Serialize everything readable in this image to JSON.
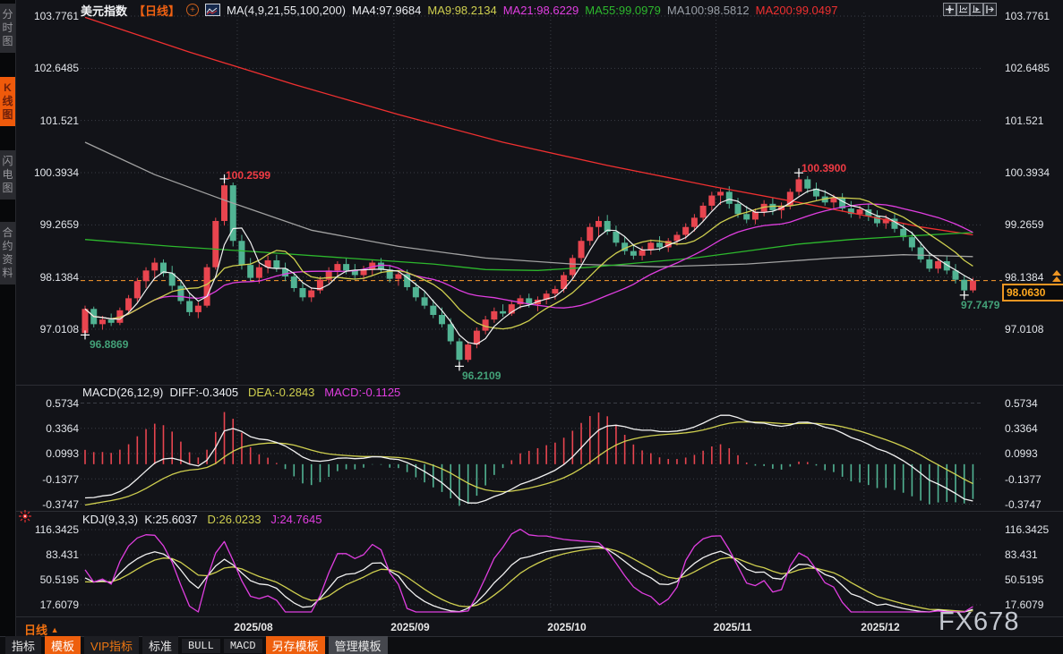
{
  "sidebar": {
    "items": [
      {
        "label": "分时图",
        "active": false
      },
      {
        "label": "K线图",
        "active": true
      },
      {
        "label": "闪电图",
        "active": false
      },
      {
        "label": "合约资料",
        "active": false
      }
    ]
  },
  "header": {
    "symbol": "美元指数",
    "period_tag": "【日线】",
    "ma_settings": "MA(4,9,21,55,100,200)",
    "ma4": "MA4:97.9684",
    "ma9": "MA9:98.2134",
    "ma21": "MA21:98.6229",
    "ma55": "MA55:99.0979",
    "ma100": "MA100:98.5812",
    "ma200": "MA200:99.0497"
  },
  "macd_header": {
    "name": "MACD(26,12,9)",
    "diff": "DIFF:-0.3405",
    "dea": "DEA:-0.2843",
    "macd": "MACD:-0.1125"
  },
  "kdj_header": {
    "name": "KDJ(9,3,3)",
    "k": "K:25.6037",
    "d": "D:26.0233",
    "j": "J:24.7645"
  },
  "annotations": {
    "high1": "100.2599",
    "low1": "96.8869",
    "low2": "96.2109",
    "high2": "100.3900",
    "low3": "97.7479",
    "last_price": "98.0630"
  },
  "timeline": {
    "period": "日线",
    "triangle": "▲",
    "dates": [
      "2025/08",
      "2025/09",
      "2025/10",
      "2025/11",
      "2025/12"
    ]
  },
  "watermark": "FX678",
  "toolbar": {
    "tabs": [
      {
        "label": "指标"
      },
      {
        "label": "模板"
      },
      {
        "label": "VIP指标"
      },
      {
        "label": "标准"
      },
      {
        "label": "BULL"
      },
      {
        "label": "MACD"
      },
      {
        "label": "另存模板"
      },
      {
        "label": "管理模板"
      }
    ]
  },
  "chart_data": {
    "type": "candlestick",
    "title": "美元指数 日线 (US Dollar Index, daily)",
    "panels": [
      "price+MA(4,9,21,55,100,200)",
      "MACD(26,12,9)",
      "KDJ(9,3,3)"
    ],
    "price_axis_ticks": [
      103.7761,
      102.6485,
      101.521,
      100.3934,
      99.2659,
      98.1384,
      97.0108
    ],
    "macd_axis_ticks": [
      0.5734,
      0.3364,
      0.0993,
      -0.1377,
      -0.3747
    ],
    "kdj_axis_ticks": [
      116.3425,
      83.431,
      50.5195,
      17.6079
    ],
    "last_price": 98.063,
    "month_labels": [
      "2025/08",
      "2025/09",
      "2025/10",
      "2025/11",
      "2025/12"
    ],
    "month_start_indices": [
      18,
      36,
      54,
      73,
      90
    ],
    "markers": [
      {
        "index": 0,
        "price": 96.8869,
        "type": "low"
      },
      {
        "index": 16,
        "price": 100.2599,
        "type": "high"
      },
      {
        "index": 43,
        "price": 96.2109,
        "type": "low"
      },
      {
        "index": 82,
        "price": 100.39,
        "type": "high"
      },
      {
        "index": 101,
        "price": 97.7479,
        "type": "low"
      }
    ],
    "ma_computed_periods": [
      4,
      9,
      21
    ],
    "ma_overlays": {
      "ma55": [
        [
          0,
          98.95
        ],
        [
          10,
          98.8
        ],
        [
          20,
          98.68
        ],
        [
          30,
          98.55
        ],
        [
          40,
          98.42
        ],
        [
          46,
          98.3
        ],
        [
          52,
          98.28
        ],
        [
          58,
          98.35
        ],
        [
          64,
          98.45
        ],
        [
          70,
          98.55
        ],
        [
          76,
          98.7
        ],
        [
          82,
          98.85
        ],
        [
          88,
          98.95
        ],
        [
          94,
          99.02
        ],
        [
          102,
          99.1
        ]
      ],
      "ma100": [
        [
          0,
          101.05
        ],
        [
          8,
          100.35
        ],
        [
          16,
          99.8
        ],
        [
          26,
          99.15
        ],
        [
          36,
          98.8
        ],
        [
          46,
          98.55
        ],
        [
          56,
          98.42
        ],
        [
          66,
          98.36
        ],
        [
          76,
          98.42
        ],
        [
          86,
          98.55
        ],
        [
          94,
          98.62
        ],
        [
          102,
          98.58
        ]
      ],
      "ma200": [
        [
          0,
          103.75
        ],
        [
          12,
          103.0
        ],
        [
          24,
          102.3
        ],
        [
          36,
          101.65
        ],
        [
          48,
          101.05
        ],
        [
          60,
          100.55
        ],
        [
          72,
          100.1
        ],
        [
          82,
          99.75
        ],
        [
          90,
          99.45
        ],
        [
          96,
          99.22
        ],
        [
          102,
          99.05
        ]
      ]
    },
    "macd": {
      "fast": 12,
      "slow": 26,
      "signal": 9,
      "last": {
        "diff": -0.3405,
        "dea": -0.2843,
        "macd": -0.1125
      }
    },
    "kdj": {
      "n": 9,
      "m1": 3,
      "m2": 3,
      "last": {
        "k": 25.6037,
        "d": 26.0233,
        "j": 24.7645
      }
    },
    "colors": {
      "up": "#e8454f",
      "down": "#51b393",
      "ma4": "#f2f2f2",
      "ma9": "#cfcf4f",
      "ma21": "#e03ee0",
      "ma55": "#2db82d",
      "ma100": "#a2a2a2",
      "ma200": "#f03030",
      "diff": "#f2f2f2",
      "dea": "#cfcf4f",
      "hist_pos": "#e8454f",
      "hist_neg": "#51b393",
      "k": "#f2f2f2",
      "d": "#cfcf4f",
      "j": "#e03ee0",
      "last_price": "#ff9d2e",
      "grid": "#3b3e46",
      "marker_cross": "#ffffff",
      "annotation_high": "#f03b44",
      "annotation_low": "#43a178"
    },
    "candles": [
      [
        96.93,
        97.52,
        96.8869,
        97.45
      ],
      [
        97.45,
        97.5,
        97.05,
        97.12
      ],
      [
        97.12,
        97.3,
        97.0,
        97.22
      ],
      [
        97.22,
        97.35,
        97.08,
        97.15
      ],
      [
        97.15,
        97.48,
        97.1,
        97.42
      ],
      [
        97.42,
        97.75,
        97.35,
        97.68
      ],
      [
        97.68,
        98.12,
        97.6,
        98.05
      ],
      [
        98.05,
        98.35,
        97.9,
        98.28
      ],
      [
        98.28,
        98.55,
        98.1,
        98.45
      ],
      [
        98.45,
        98.52,
        98.15,
        98.22
      ],
      [
        98.22,
        98.38,
        97.85,
        97.95
      ],
      [
        97.95,
        98.05,
        97.55,
        97.62
      ],
      [
        97.62,
        97.8,
        97.3,
        97.38
      ],
      [
        97.38,
        97.6,
        97.25,
        97.52
      ],
      [
        97.52,
        98.42,
        97.48,
        98.35
      ],
      [
        98.35,
        99.42,
        98.3,
        99.35
      ],
      [
        99.35,
        100.2599,
        99.25,
        100.12
      ],
      [
        100.12,
        100.18,
        98.8,
        98.92
      ],
      [
        98.92,
        99.05,
        98.3,
        98.4
      ],
      [
        98.4,
        98.55,
        98.05,
        98.12
      ],
      [
        98.12,
        98.42,
        98.0,
        98.35
      ],
      [
        98.35,
        98.6,
        98.22,
        98.5
      ],
      [
        98.5,
        98.62,
        98.25,
        98.32
      ],
      [
        98.32,
        98.45,
        98.05,
        98.15
      ],
      [
        98.15,
        98.25,
        97.82,
        97.9
      ],
      [
        97.9,
        98.02,
        97.62,
        97.7
      ],
      [
        97.7,
        97.92,
        97.6,
        97.85
      ],
      [
        97.85,
        98.15,
        97.78,
        98.08
      ],
      [
        98.08,
        98.35,
        98.0,
        98.28
      ],
      [
        98.28,
        98.48,
        98.15,
        98.42
      ],
      [
        98.42,
        98.55,
        98.2,
        98.28
      ],
      [
        98.28,
        98.42,
        98.1,
        98.18
      ],
      [
        98.18,
        98.38,
        98.08,
        98.3
      ],
      [
        98.3,
        98.5,
        98.18,
        98.45
      ],
      [
        98.45,
        98.55,
        98.22,
        98.3
      ],
      [
        98.3,
        98.4,
        98.02,
        98.1
      ],
      [
        98.1,
        98.28,
        97.95,
        98.2
      ],
      [
        98.2,
        98.3,
        97.85,
        97.92
      ],
      [
        97.92,
        98.02,
        97.62,
        97.7
      ],
      [
        97.7,
        97.82,
        97.45,
        97.52
      ],
      [
        97.52,
        97.65,
        97.25,
        97.32
      ],
      [
        97.32,
        97.48,
        97.05,
        97.12
      ],
      [
        97.12,
        97.25,
        96.68,
        96.75
      ],
      [
        96.75,
        96.82,
        96.2109,
        96.35
      ],
      [
        96.35,
        96.75,
        96.3,
        96.68
      ],
      [
        96.68,
        97.05,
        96.6,
        96.98
      ],
      [
        96.98,
        97.3,
        96.9,
        97.22
      ],
      [
        97.22,
        97.48,
        97.15,
        97.4
      ],
      [
        97.4,
        97.55,
        97.28,
        97.35
      ],
      [
        97.35,
        97.62,
        97.3,
        97.55
      ],
      [
        97.55,
        97.75,
        97.45,
        97.68
      ],
      [
        97.68,
        97.78,
        97.48,
        97.55
      ],
      [
        97.55,
        97.72,
        97.4,
        97.65
      ],
      [
        97.65,
        97.85,
        97.55,
        97.78
      ],
      [
        97.78,
        97.95,
        97.65,
        97.88
      ],
      [
        97.88,
        98.25,
        97.8,
        98.18
      ],
      [
        98.18,
        98.62,
        98.1,
        98.55
      ],
      [
        98.55,
        99.0,
        98.45,
        98.92
      ],
      [
        98.92,
        99.3,
        98.82,
        99.22
      ],
      [
        99.22,
        99.45,
        99.0,
        99.35
      ],
      [
        99.35,
        99.48,
        99.05,
        99.12
      ],
      [
        99.12,
        99.25,
        98.8,
        98.88
      ],
      [
        98.88,
        99.02,
        98.62,
        98.7
      ],
      [
        98.7,
        98.85,
        98.52,
        98.6
      ],
      [
        98.6,
        98.8,
        98.5,
        98.72
      ],
      [
        98.72,
        98.95,
        98.62,
        98.88
      ],
      [
        98.88,
        99.02,
        98.7,
        98.78
      ],
      [
        98.78,
        98.98,
        98.68,
        98.92
      ],
      [
        98.92,
        99.12,
        98.82,
        99.05
      ],
      [
        99.05,
        99.3,
        98.95,
        99.22
      ],
      [
        99.22,
        99.5,
        99.12,
        99.42
      ],
      [
        99.42,
        99.75,
        99.35,
        99.68
      ],
      [
        99.68,
        99.98,
        99.58,
        99.9
      ],
      [
        99.9,
        100.05,
        99.7,
        99.98
      ],
      [
        99.98,
        100.1,
        99.62,
        99.72
      ],
      [
        99.72,
        99.85,
        99.42,
        99.5
      ],
      [
        99.5,
        99.68,
        99.3,
        99.38
      ],
      [
        99.38,
        99.62,
        99.28,
        99.55
      ],
      [
        99.55,
        99.8,
        99.45,
        99.72
      ],
      [
        99.72,
        99.85,
        99.48,
        99.58
      ],
      [
        99.58,
        99.75,
        99.4,
        99.68
      ],
      [
        99.68,
        100.05,
        99.6,
        99.98
      ],
      [
        99.98,
        100.39,
        99.9,
        100.25
      ],
      [
        100.25,
        100.32,
        99.95,
        100.05
      ],
      [
        100.05,
        100.18,
        99.8,
        99.88
      ],
      [
        99.88,
        100.02,
        99.68,
        99.75
      ],
      [
        99.75,
        99.92,
        99.6,
        99.85
      ],
      [
        99.85,
        99.95,
        99.55,
        99.62
      ],
      [
        99.62,
        99.78,
        99.42,
        99.5
      ],
      [
        99.5,
        99.68,
        99.4,
        99.6
      ],
      [
        99.6,
        99.72,
        99.35,
        99.45
      ],
      [
        99.45,
        99.58,
        99.22,
        99.3
      ],
      [
        99.3,
        99.48,
        99.18,
        99.4
      ],
      [
        99.4,
        99.5,
        99.1,
        99.18
      ],
      [
        99.18,
        99.3,
        98.92,
        99.0
      ],
      [
        99.0,
        99.12,
        98.7,
        98.78
      ],
      [
        98.78,
        98.9,
        98.45,
        98.52
      ],
      [
        98.52,
        98.68,
        98.25,
        98.32
      ],
      [
        98.32,
        98.55,
        98.22,
        98.48
      ],
      [
        98.48,
        98.6,
        98.2,
        98.28
      ],
      [
        98.28,
        98.42,
        98.0,
        98.08
      ],
      [
        98.08,
        98.18,
        97.7479,
        97.85
      ],
      [
        97.85,
        98.12,
        97.8,
        98.063
      ]
    ]
  }
}
